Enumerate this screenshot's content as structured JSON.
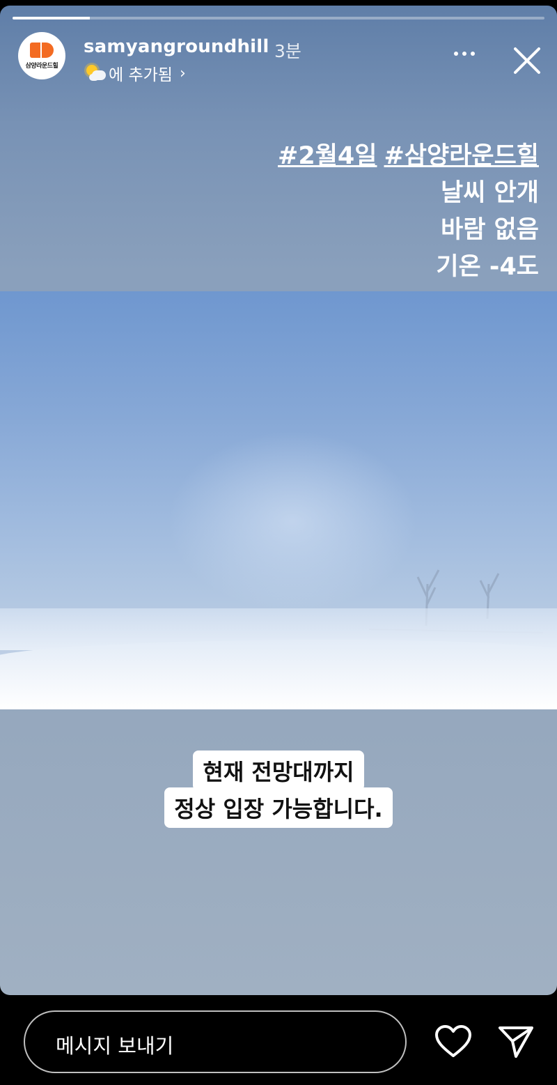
{
  "story": {
    "progress": 0.145,
    "username": "samyangroundhill",
    "time_ago": "3분",
    "avatar_text": "삼양라운드힐",
    "added_to": "에 추가됨",
    "added_icon": "sun-behind-cloud-icon",
    "colors": {
      "brand_orange": "#f36b22",
      "text": "#ffffff"
    }
  },
  "caption": {
    "tag_date": "#2월4일",
    "tag_place": "#삼양라운드힐",
    "line_weather": "날씨 안개",
    "line_wind": "바람 없음",
    "line_temp": "기온 -4도"
  },
  "sticker": {
    "line1": "현재 전망대까지",
    "line2": "정상 입장 가능합니다."
  },
  "reply": {
    "placeholder": "메시지 보내기"
  }
}
